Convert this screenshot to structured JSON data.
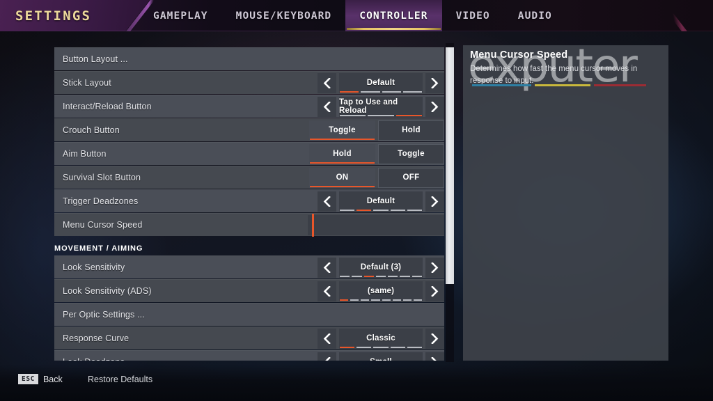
{
  "header": {
    "title": "SETTINGS",
    "tabs": [
      {
        "label": "GAMEPLAY",
        "active": false
      },
      {
        "label": "MOUSE/KEYBOARD",
        "active": false
      },
      {
        "label": "CONTROLLER",
        "active": true
      },
      {
        "label": "VIDEO",
        "active": false
      },
      {
        "label": "AUDIO",
        "active": false
      }
    ]
  },
  "colors": {
    "accent_orange": "#e8562a",
    "tab_active_gold": "#e6c463",
    "tab_active_purple": "#59316a",
    "title_gold": "#ecd89a",
    "row_bg": "#4a4e57",
    "control_bg": "#3b3f47"
  },
  "rows": [
    {
      "label": "Button Layout ...",
      "type": "link"
    },
    {
      "label": "Stick Layout",
      "type": "stepper",
      "value": "Default",
      "segments": 4,
      "active_segment": 1
    },
    {
      "label": "Interact/Reload Button",
      "type": "stepper",
      "value": "Tap to Use and Reload",
      "segments": 3,
      "active_segment": 3
    },
    {
      "label": "Crouch Button",
      "type": "toggle",
      "options": [
        "Toggle",
        "Hold"
      ],
      "selected": "Toggle"
    },
    {
      "label": "Aim Button",
      "type": "toggle",
      "options": [
        "Hold",
        "Toggle"
      ],
      "selected": "Hold"
    },
    {
      "label": "Survival Slot Button",
      "type": "toggle",
      "options": [
        "ON",
        "OFF"
      ],
      "selected": "ON"
    },
    {
      "label": "Trigger Deadzones",
      "type": "stepper",
      "value": "Default",
      "segments": 5,
      "active_segment": 2
    },
    {
      "label": "Menu Cursor Speed",
      "type": "slider",
      "value_percent": 2
    }
  ],
  "section": {
    "label": "MOVEMENT / AIMING",
    "rows": [
      {
        "label": "Look Sensitivity",
        "type": "stepper",
        "value": "Default (3)",
        "segments": 7,
        "active_segment": 3
      },
      {
        "label": "Look Sensitivity  (ADS)",
        "type": "stepper",
        "value": "(same)",
        "segments": 8,
        "active_segment": 1
      },
      {
        "label": "Per Optic Settings ...",
        "type": "link"
      },
      {
        "label": "Response Curve",
        "type": "stepper",
        "value": "Classic",
        "segments": 5,
        "active_segment": 1
      },
      {
        "label": "Look Deadzone",
        "type": "stepper",
        "value": "Small",
        "segments": 4,
        "active_segment": 1
      }
    ]
  },
  "info_panel": {
    "title": "Menu Cursor Speed",
    "description": "Determines how fast the menu cursor moves in response to input."
  },
  "watermark": {
    "text": "exputer"
  },
  "footer": {
    "back_key": "ESC",
    "back_label": "Back",
    "restore_label": "Restore Defaults"
  },
  "icons": {
    "left_arrow": "chevron-left-icon",
    "right_arrow": "chevron-right-icon"
  }
}
